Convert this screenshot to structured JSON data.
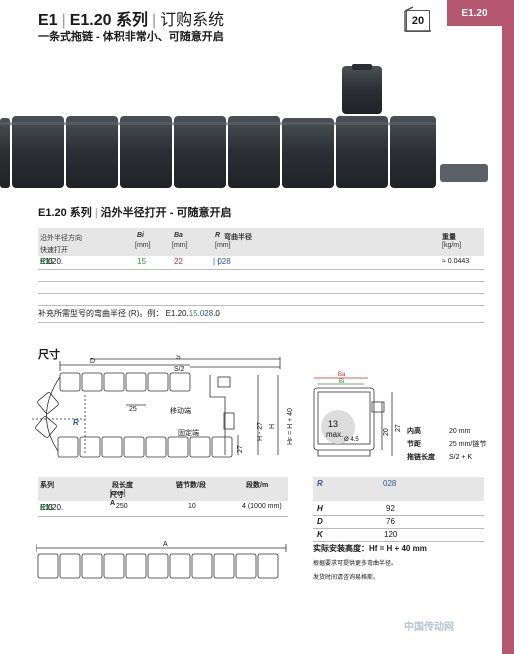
{
  "header": {
    "series_code": "E1",
    "series_name": "E1.20 系列",
    "section": "订购系统",
    "subtitle": "一条式拖链 - 体积非常小、可随意开启",
    "page_number": "20",
    "tab_label": "E1.20"
  },
  "section": {
    "title_series": "E1.20 系列",
    "title_desc": "沿外半径打开 - 可随意开启"
  },
  "table": {
    "col_open_1": "沿外半径方向",
    "col_open_2": "快速打开",
    "col_bi": "Bi",
    "col_bi_unit": "[mm]",
    "col_ba": "Ba",
    "col_ba_unit": "[mm]",
    "col_r": "R",
    "col_r_label": "弯曲半径",
    "col_r_unit": "[mm]",
    "col_weight": "重量",
    "col_weight_unit": "[kg/m]",
    "row": {
      "part_prefix": "E1.20.",
      "part_mid": "015",
      "part_dot": ".",
      "part_r": "R",
      "part_suffix": ".0",
      "bi": "15",
      "ba": "22",
      "r": "028",
      "weight": "≈ 0.0443"
    }
  },
  "note": {
    "text": "补充所需型号的弯曲半径 (R)。例：",
    "example_prefix": "E1.20.",
    "example_mid": "15",
    "example_dot": ".",
    "example_r": "028",
    "example_suffix": ".0"
  },
  "dimensions": {
    "title": "尺寸",
    "label_s": "S",
    "label_s2": "S/2",
    "label_d": "D",
    "label_25": "25",
    "label_moving": "移动端",
    "label_fixed": "固定端",
    "label_r": "R",
    "label_h27": "H - 27",
    "label_h": "H",
    "label_hf": "H",
    "label_hf_sub": "F",
    "label_hf_rest": " = H + 40",
    "label_27": "27",
    "label_a": "A"
  },
  "cross_section": {
    "ba": "Ba",
    "bi": "Bi",
    "max_value": "13",
    "max_text": "max.",
    "dia": "Ø 4.5",
    "h20": "20",
    "h27": "27"
  },
  "specs": {
    "inner_height_label": "内高",
    "inner_height_value": "20 mm",
    "pitch_label": "节距",
    "pitch_value": "25 mm/链节",
    "length_label": "拖链长度",
    "length_value": "S/2 + K"
  },
  "lower_table": {
    "col_series": "系列",
    "col_len_1": "段长度",
    "col_len_2": "尺寸 A",
    "col_len_unit": "[mm]",
    "col_links": "链节数/段",
    "col_count": "段数/m",
    "row": {
      "part_prefix": "E1.20.",
      "part_mid": "015",
      "part_dot": ".",
      "part_r": "R",
      "part_suffix": ".0",
      "length": "250",
      "links": "10",
      "count": "4 (1000 mm)"
    }
  },
  "radius_table": {
    "r_label": "R",
    "r_value": "028",
    "rows": [
      {
        "label": "H",
        "value": "92"
      },
      {
        "label": "D",
        "value": "76"
      },
      {
        "label": "K",
        "value": "120"
      }
    ]
  },
  "install": {
    "text": "实际安装高度：",
    "formula": "Hf = H + 40 mm"
  },
  "footnotes": {
    "line1": "根据要求可提供更多弯曲半径。",
    "line2": "发货时间请咨询易格斯。"
  },
  "watermark": "中国传动网"
}
